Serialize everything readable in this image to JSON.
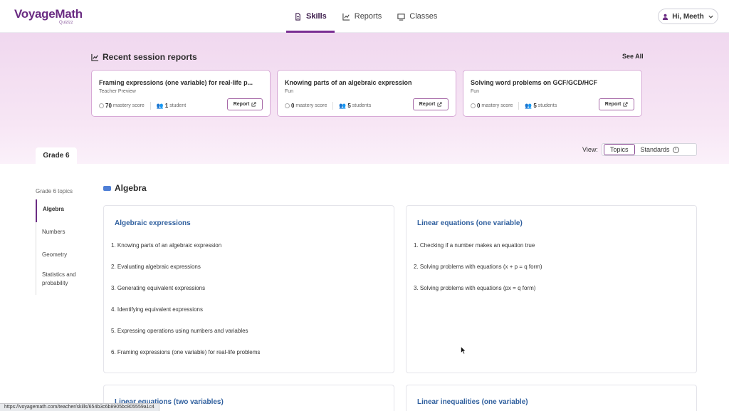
{
  "app": {
    "logo": "VoyageMath",
    "logo_sub": "Quizizz"
  },
  "nav": {
    "tabs": [
      {
        "label": "Skills"
      },
      {
        "label": "Reports"
      },
      {
        "label": "Classes"
      }
    ]
  },
  "user": {
    "greeting": "Hi, Meeth"
  },
  "recent": {
    "title": "Recent session reports",
    "see_all": "See All",
    "cards": [
      {
        "title": "Framing expressions (one variable) for real-life p...",
        "type": "Teacher Preview",
        "score": "70",
        "score_label": "mastery score",
        "students": "1",
        "students_label": "student",
        "button": "Report"
      },
      {
        "title": "Knowing parts of an algebraic expression",
        "type": "Fun",
        "score": "0",
        "score_label": "mastery score",
        "students": "5",
        "students_label": "students",
        "button": "Report"
      },
      {
        "title": "Solving word problems on GCF/GCD/HCF",
        "type": "Fun",
        "score": "0",
        "score_label": "mastery score",
        "students": "5",
        "students_label": "students",
        "button": "Report"
      }
    ]
  },
  "grade": {
    "tab": "Grade 6"
  },
  "view": {
    "label": "View:",
    "options": [
      "Topics",
      "Standards"
    ],
    "selected": "Topics"
  },
  "sidebar": {
    "heading": "Grade 6 topics",
    "items": [
      {
        "label": "Algebra"
      },
      {
        "label": "Numbers"
      },
      {
        "label": "Geometry"
      },
      {
        "label": "Statistics and probability"
      }
    ]
  },
  "main": {
    "section": "Algebra",
    "topics": [
      {
        "title": "Algebraic expressions",
        "skills": [
          "1. Knowing parts of an algebraic expression",
          "2. Evaluating algebraic expressions",
          "3. Generating equivalent expressions",
          "4. Identifying equivalent expressions",
          "5. Expressing operations using numbers and variables",
          "6. Framing expressions (one variable) for real-life problems"
        ]
      },
      {
        "title": "Linear equations (one variable)",
        "skills": [
          "1. Checking if a number makes an equation true",
          "2. Solving problems with equations (x + p = q form)",
          "3. Solving problems with equations (px = q form)"
        ]
      },
      {
        "title": "Linear equations (two variables)",
        "skills": []
      },
      {
        "title": "Linear inequalities (one variable)",
        "skills": []
      }
    ]
  },
  "status_url": "https://voyagemath.com/teacher/skills/654b3c6b8905bc805559a1c4",
  "colors": {
    "brand": "#6b2d83",
    "topic_title": "#2f5f9e",
    "band": "#f0d8ef",
    "card_border": "#d7a9d6"
  }
}
